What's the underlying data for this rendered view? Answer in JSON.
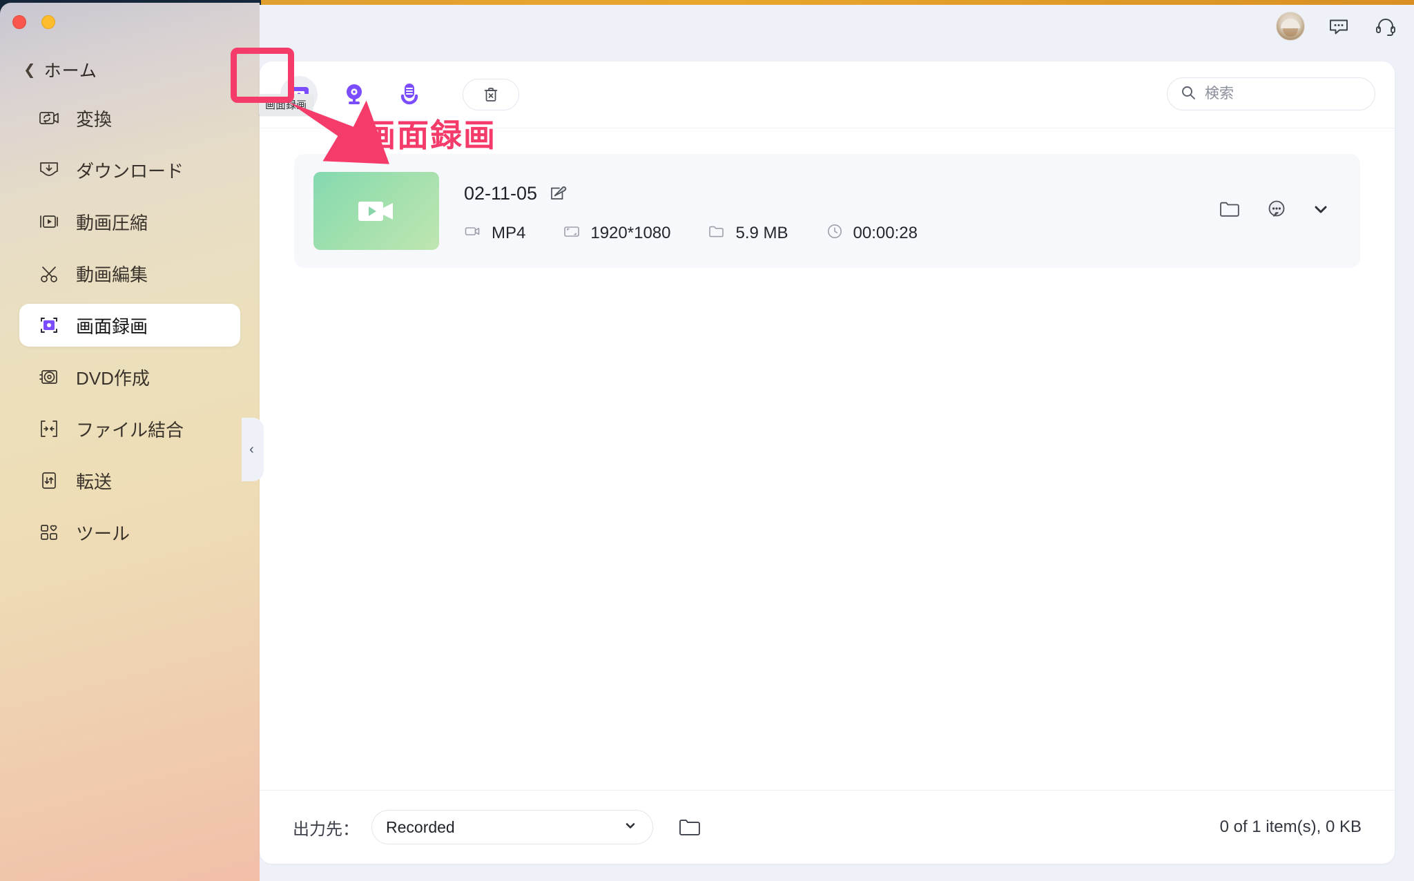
{
  "window": {
    "controls": [
      "close",
      "minimize"
    ]
  },
  "sidebar": {
    "back_label": "ホーム",
    "items": [
      {
        "label": "変換",
        "icon": "convert-icon",
        "active": false
      },
      {
        "label": "ダウンロード",
        "icon": "download-icon",
        "active": false
      },
      {
        "label": "動画圧縮",
        "icon": "compress-icon",
        "active": false
      },
      {
        "label": "動画編集",
        "icon": "scissors-icon",
        "active": false
      },
      {
        "label": "画面録画",
        "icon": "screen-record-icon",
        "active": true
      },
      {
        "label": "DVD作成",
        "icon": "dvd-icon",
        "active": false
      },
      {
        "label": "ファイル結合",
        "icon": "merge-icon",
        "active": false
      },
      {
        "label": "転送",
        "icon": "transfer-icon",
        "active": false
      },
      {
        "label": "ツール",
        "icon": "tools-icon",
        "active": false
      }
    ],
    "collapse_handle": "‹"
  },
  "topbar": {
    "avatar": "avatar",
    "message_icon": "message-bubble-icon",
    "support_icon": "headset-icon"
  },
  "toolbar": {
    "buttons": [
      {
        "name": "screen-recorder-icon",
        "label": "画面録画",
        "selected": true
      },
      {
        "name": "webcam-icon",
        "label": "カメラ録画",
        "selected": false
      },
      {
        "name": "microphone-icon",
        "label": "音声録音",
        "selected": false
      }
    ],
    "delete_icon": "trash-delete-icon",
    "tooltip": "画面録画"
  },
  "search": {
    "placeholder": "検索",
    "value": "",
    "icon": "search-icon"
  },
  "file_row": {
    "thumbnail_icon": "video-camera-icon",
    "name": "02-11-05",
    "edit_icon": "edit-pencil-icon",
    "specs": [
      {
        "icon": "video-format-icon",
        "value": "MP4"
      },
      {
        "icon": "resolution-icon",
        "value": "1920*1080"
      },
      {
        "icon": "file-size-icon",
        "value": "5.9 MB"
      },
      {
        "icon": "clock-icon",
        "value": "00:00:28"
      }
    ],
    "actions": [
      {
        "icon": "open-folder-icon"
      },
      {
        "icon": "more-options-icon"
      },
      {
        "icon": "chevron-down-icon"
      }
    ]
  },
  "bottom": {
    "output_label": "出力先：",
    "output_value": "Recorded",
    "caret": "⌄",
    "folder_icon": "folder-open-icon",
    "status": "0 of 1 item(s), 0 KB"
  },
  "annotation": {
    "callout_text": "画面録画",
    "highlight_color": "#f43b6a"
  }
}
